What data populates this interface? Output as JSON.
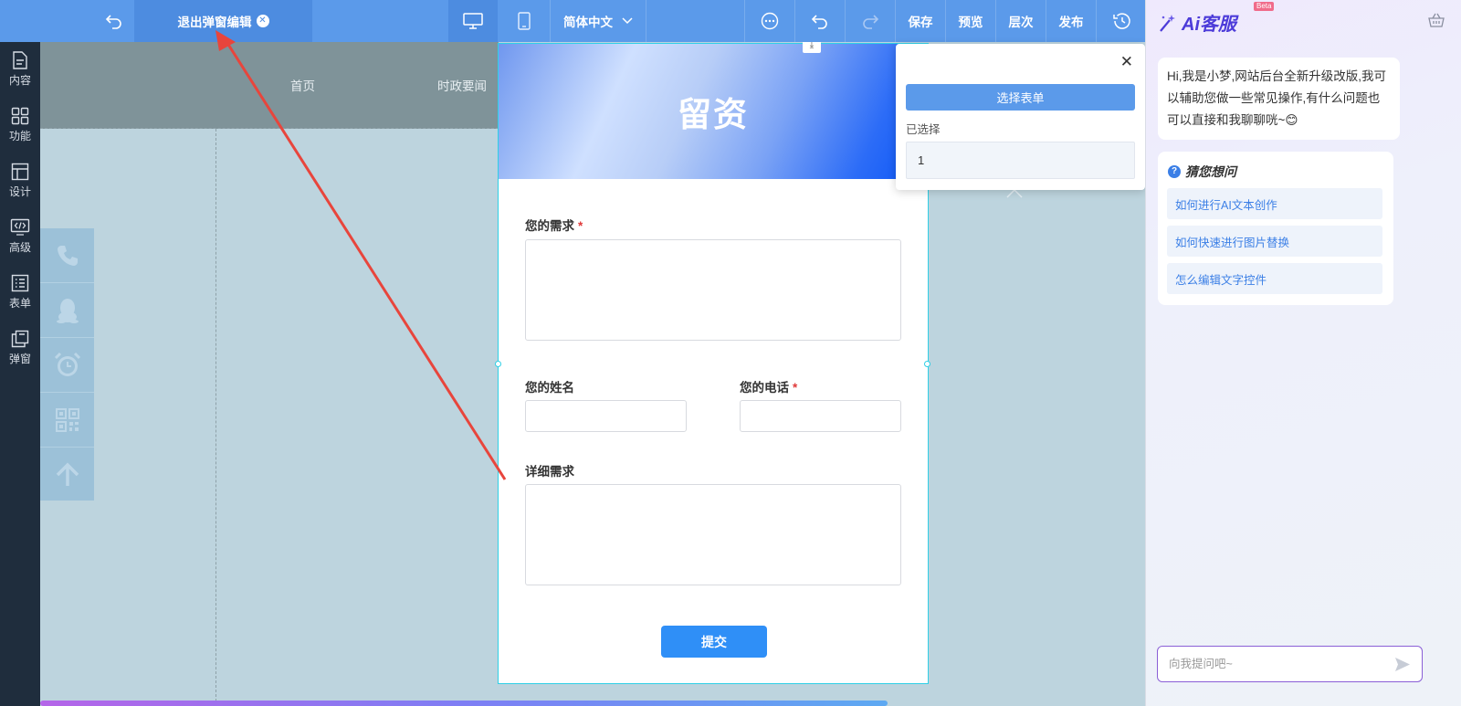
{
  "topbar": {
    "exit_label": "退出弹窗编辑",
    "language": "简体中文",
    "save": "保存",
    "preview": "预览",
    "layers": "层次",
    "publish": "发布"
  },
  "sidebar": {
    "items": [
      {
        "label": "内容",
        "icon": "document-icon"
      },
      {
        "label": "功能",
        "icon": "grid-icon"
      },
      {
        "label": "设计",
        "icon": "layout-icon"
      },
      {
        "label": "高级",
        "icon": "code-monitor-icon"
      },
      {
        "label": "表单",
        "icon": "form-list-icon"
      },
      {
        "label": "弹窗",
        "icon": "popup-icon"
      }
    ]
  },
  "canvas": {
    "nav": [
      "首页",
      "时政要闻"
    ],
    "float_buttons": [
      "phone-icon",
      "qq-icon",
      "alarm-clock-icon",
      "qrcode-icon",
      "arrow-up-icon"
    ]
  },
  "popup": {
    "banner_title": "留资",
    "fields": {
      "need_label": "您的需求",
      "name_label": "您的姓名",
      "phone_label": "您的电话",
      "detail_label": "详细需求",
      "required_mark": "*"
    },
    "submit": "提交"
  },
  "select_panel": {
    "button": "选择表单",
    "selected_label": "已选择",
    "selected_value": "1"
  },
  "ai": {
    "logo": "Ai客服",
    "beta": "Beta",
    "greeting": "Hi,我是小梦,网站后台全新升级改版,我可以辅助您做一些常见操作,有什么问题也可以直接和我聊聊咣~😊",
    "guess_title": "猜您想问",
    "questions": [
      "如何进行AI文本创作",
      "如何快速进行图片替换",
      "怎么编辑文字控件"
    ],
    "input_placeholder": "向我提问吧~"
  },
  "colors": {
    "topbar": "#5b9aea",
    "sidebar": "#1f2d3d",
    "accent": "#2f8ff7",
    "annotation_arrow": "#e8453c"
  }
}
